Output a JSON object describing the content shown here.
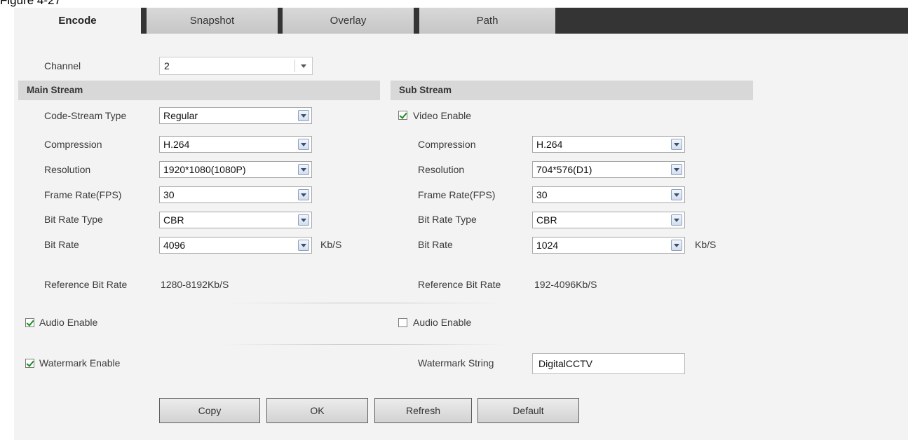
{
  "caption": "Figure 4-27",
  "tabs": [
    {
      "label": "Encode"
    },
    {
      "label": "Snapshot"
    },
    {
      "label": "Overlay"
    },
    {
      "label": "Path"
    }
  ],
  "channel": {
    "label": "Channel",
    "value": "2"
  },
  "main_stream": {
    "title": "Main Stream",
    "code_stream_type": {
      "label": "Code-Stream Type",
      "value": "Regular"
    },
    "compression": {
      "label": "Compression",
      "value": "H.264"
    },
    "resolution": {
      "label": "Resolution",
      "value": "1920*1080(1080P)"
    },
    "frame_rate": {
      "label": "Frame Rate(FPS)",
      "value": "30"
    },
    "bit_rate_type": {
      "label": "Bit Rate Type",
      "value": "CBR"
    },
    "bit_rate": {
      "label": "Bit Rate",
      "value": "4096",
      "unit": "Kb/S"
    },
    "reference_bit_rate": {
      "label": "Reference Bit Rate",
      "value": "1280-8192Kb/S"
    },
    "audio_enable": {
      "label": "Audio Enable",
      "checked": true
    },
    "watermark_enable": {
      "label": "Watermark Enable",
      "checked": true
    }
  },
  "sub_stream": {
    "title": "Sub Stream",
    "video_enable": {
      "label": "Video Enable",
      "checked": true
    },
    "compression": {
      "label": "Compression",
      "value": "H.264"
    },
    "resolution": {
      "label": "Resolution",
      "value": "704*576(D1)"
    },
    "frame_rate": {
      "label": "Frame Rate(FPS)",
      "value": "30"
    },
    "bit_rate_type": {
      "label": "Bit Rate Type",
      "value": "CBR"
    },
    "bit_rate": {
      "label": "Bit Rate",
      "value": "1024",
      "unit": "Kb/S"
    },
    "reference_bit_rate": {
      "label": "Reference Bit Rate",
      "value": "192-4096Kb/S"
    },
    "audio_enable": {
      "label": "Audio Enable",
      "checked": false
    },
    "watermark_string": {
      "label": "Watermark String",
      "value": "DigitalCCTV"
    }
  },
  "buttons": {
    "copy": "Copy",
    "ok": "OK",
    "refresh": "Refresh",
    "default": "Default"
  },
  "colors": {
    "tabbar_bg": "#343434",
    "panel_bg": "#f3f3f3",
    "section_header_bg": "#d8d8d8",
    "check_color": "#1c8c1c"
  }
}
